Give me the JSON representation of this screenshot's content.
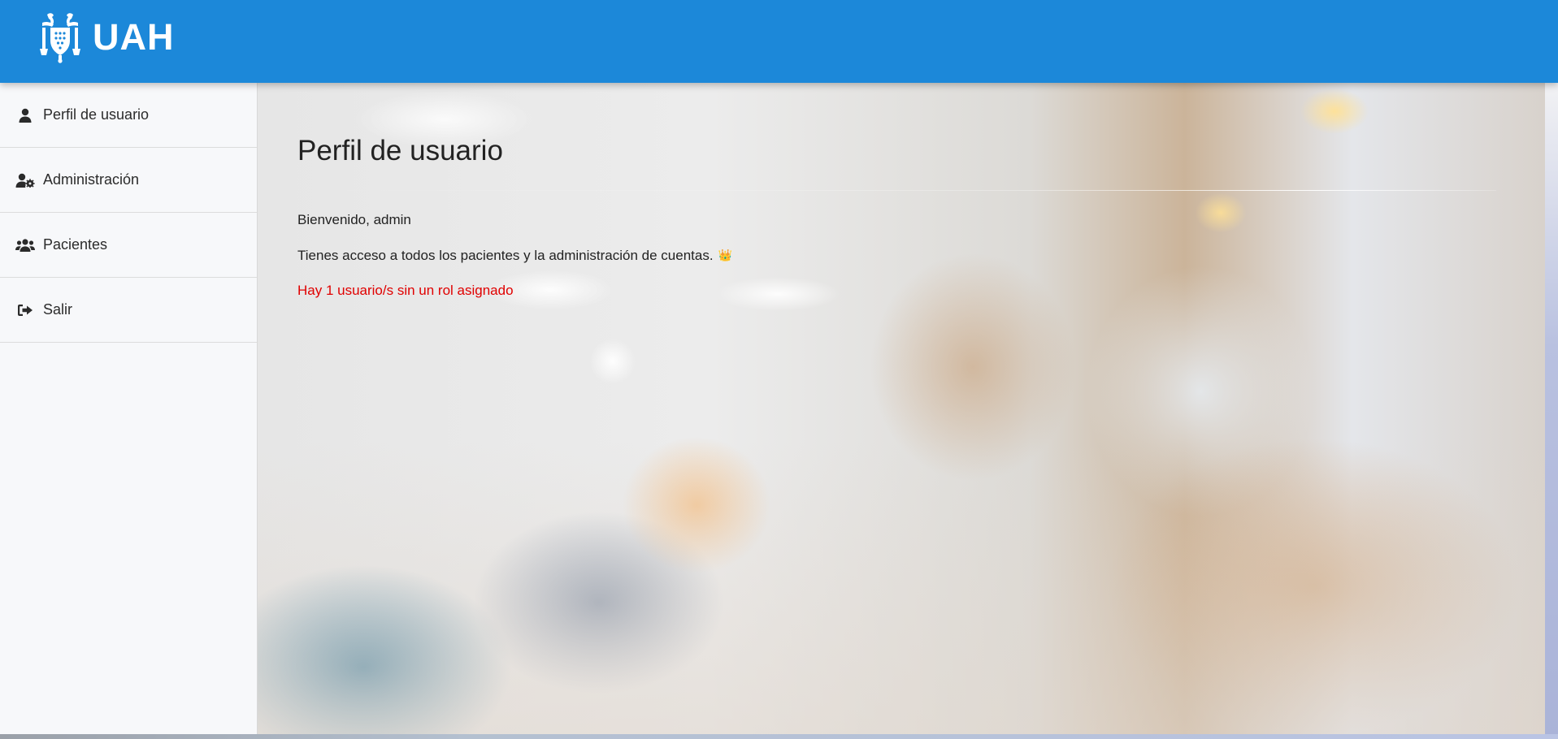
{
  "header": {
    "brand_text": "UAH",
    "background_color": "#1c88d9",
    "logo_icon": "uah-crest-logo"
  },
  "sidebar": {
    "items": [
      {
        "label": "Perfil de usuario",
        "icon": "user-icon"
      },
      {
        "label": "Administración",
        "icon": "user-cog-icon"
      },
      {
        "label": "Pacientes",
        "icon": "users-icon"
      },
      {
        "label": "Salir",
        "icon": "sign-out-icon"
      }
    ]
  },
  "main": {
    "title": "Perfil de usuario",
    "welcome": "Bienvenido, admin",
    "access_message": "Tienes acceso a todos los pacientes y la administración de cuentas.",
    "access_emoji": "👑",
    "alert_message": "Hay 1 usuario/s sin un rol asignado",
    "alert_color": "#e00000"
  }
}
